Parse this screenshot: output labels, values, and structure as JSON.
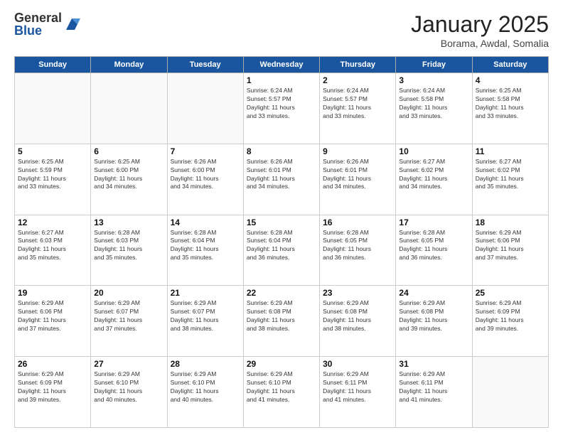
{
  "header": {
    "logo_general": "General",
    "logo_blue": "Blue",
    "month_title": "January 2025",
    "location": "Borama, Awdal, Somalia"
  },
  "weekdays": [
    "Sunday",
    "Monday",
    "Tuesday",
    "Wednesday",
    "Thursday",
    "Friday",
    "Saturday"
  ],
  "weeks": [
    [
      {
        "day": "",
        "info": ""
      },
      {
        "day": "",
        "info": ""
      },
      {
        "day": "",
        "info": ""
      },
      {
        "day": "1",
        "info": "Sunrise: 6:24 AM\nSunset: 5:57 PM\nDaylight: 11 hours\nand 33 minutes."
      },
      {
        "day": "2",
        "info": "Sunrise: 6:24 AM\nSunset: 5:57 PM\nDaylight: 11 hours\nand 33 minutes."
      },
      {
        "day": "3",
        "info": "Sunrise: 6:24 AM\nSunset: 5:58 PM\nDaylight: 11 hours\nand 33 minutes."
      },
      {
        "day": "4",
        "info": "Sunrise: 6:25 AM\nSunset: 5:58 PM\nDaylight: 11 hours\nand 33 minutes."
      }
    ],
    [
      {
        "day": "5",
        "info": "Sunrise: 6:25 AM\nSunset: 5:59 PM\nDaylight: 11 hours\nand 33 minutes."
      },
      {
        "day": "6",
        "info": "Sunrise: 6:25 AM\nSunset: 6:00 PM\nDaylight: 11 hours\nand 34 minutes."
      },
      {
        "day": "7",
        "info": "Sunrise: 6:26 AM\nSunset: 6:00 PM\nDaylight: 11 hours\nand 34 minutes."
      },
      {
        "day": "8",
        "info": "Sunrise: 6:26 AM\nSunset: 6:01 PM\nDaylight: 11 hours\nand 34 minutes."
      },
      {
        "day": "9",
        "info": "Sunrise: 6:26 AM\nSunset: 6:01 PM\nDaylight: 11 hours\nand 34 minutes."
      },
      {
        "day": "10",
        "info": "Sunrise: 6:27 AM\nSunset: 6:02 PM\nDaylight: 11 hours\nand 34 minutes."
      },
      {
        "day": "11",
        "info": "Sunrise: 6:27 AM\nSunset: 6:02 PM\nDaylight: 11 hours\nand 35 minutes."
      }
    ],
    [
      {
        "day": "12",
        "info": "Sunrise: 6:27 AM\nSunset: 6:03 PM\nDaylight: 11 hours\nand 35 minutes."
      },
      {
        "day": "13",
        "info": "Sunrise: 6:28 AM\nSunset: 6:03 PM\nDaylight: 11 hours\nand 35 minutes."
      },
      {
        "day": "14",
        "info": "Sunrise: 6:28 AM\nSunset: 6:04 PM\nDaylight: 11 hours\nand 35 minutes."
      },
      {
        "day": "15",
        "info": "Sunrise: 6:28 AM\nSunset: 6:04 PM\nDaylight: 11 hours\nand 36 minutes."
      },
      {
        "day": "16",
        "info": "Sunrise: 6:28 AM\nSunset: 6:05 PM\nDaylight: 11 hours\nand 36 minutes."
      },
      {
        "day": "17",
        "info": "Sunrise: 6:28 AM\nSunset: 6:05 PM\nDaylight: 11 hours\nand 36 minutes."
      },
      {
        "day": "18",
        "info": "Sunrise: 6:29 AM\nSunset: 6:06 PM\nDaylight: 11 hours\nand 37 minutes."
      }
    ],
    [
      {
        "day": "19",
        "info": "Sunrise: 6:29 AM\nSunset: 6:06 PM\nDaylight: 11 hours\nand 37 minutes."
      },
      {
        "day": "20",
        "info": "Sunrise: 6:29 AM\nSunset: 6:07 PM\nDaylight: 11 hours\nand 37 minutes."
      },
      {
        "day": "21",
        "info": "Sunrise: 6:29 AM\nSunset: 6:07 PM\nDaylight: 11 hours\nand 38 minutes."
      },
      {
        "day": "22",
        "info": "Sunrise: 6:29 AM\nSunset: 6:08 PM\nDaylight: 11 hours\nand 38 minutes."
      },
      {
        "day": "23",
        "info": "Sunrise: 6:29 AM\nSunset: 6:08 PM\nDaylight: 11 hours\nand 38 minutes."
      },
      {
        "day": "24",
        "info": "Sunrise: 6:29 AM\nSunset: 6:08 PM\nDaylight: 11 hours\nand 39 minutes."
      },
      {
        "day": "25",
        "info": "Sunrise: 6:29 AM\nSunset: 6:09 PM\nDaylight: 11 hours\nand 39 minutes."
      }
    ],
    [
      {
        "day": "26",
        "info": "Sunrise: 6:29 AM\nSunset: 6:09 PM\nDaylight: 11 hours\nand 39 minutes."
      },
      {
        "day": "27",
        "info": "Sunrise: 6:29 AM\nSunset: 6:10 PM\nDaylight: 11 hours\nand 40 minutes."
      },
      {
        "day": "28",
        "info": "Sunrise: 6:29 AM\nSunset: 6:10 PM\nDaylight: 11 hours\nand 40 minutes."
      },
      {
        "day": "29",
        "info": "Sunrise: 6:29 AM\nSunset: 6:10 PM\nDaylight: 11 hours\nand 41 minutes."
      },
      {
        "day": "30",
        "info": "Sunrise: 6:29 AM\nSunset: 6:11 PM\nDaylight: 11 hours\nand 41 minutes."
      },
      {
        "day": "31",
        "info": "Sunrise: 6:29 AM\nSunset: 6:11 PM\nDaylight: 11 hours\nand 41 minutes."
      },
      {
        "day": "",
        "info": ""
      }
    ]
  ]
}
